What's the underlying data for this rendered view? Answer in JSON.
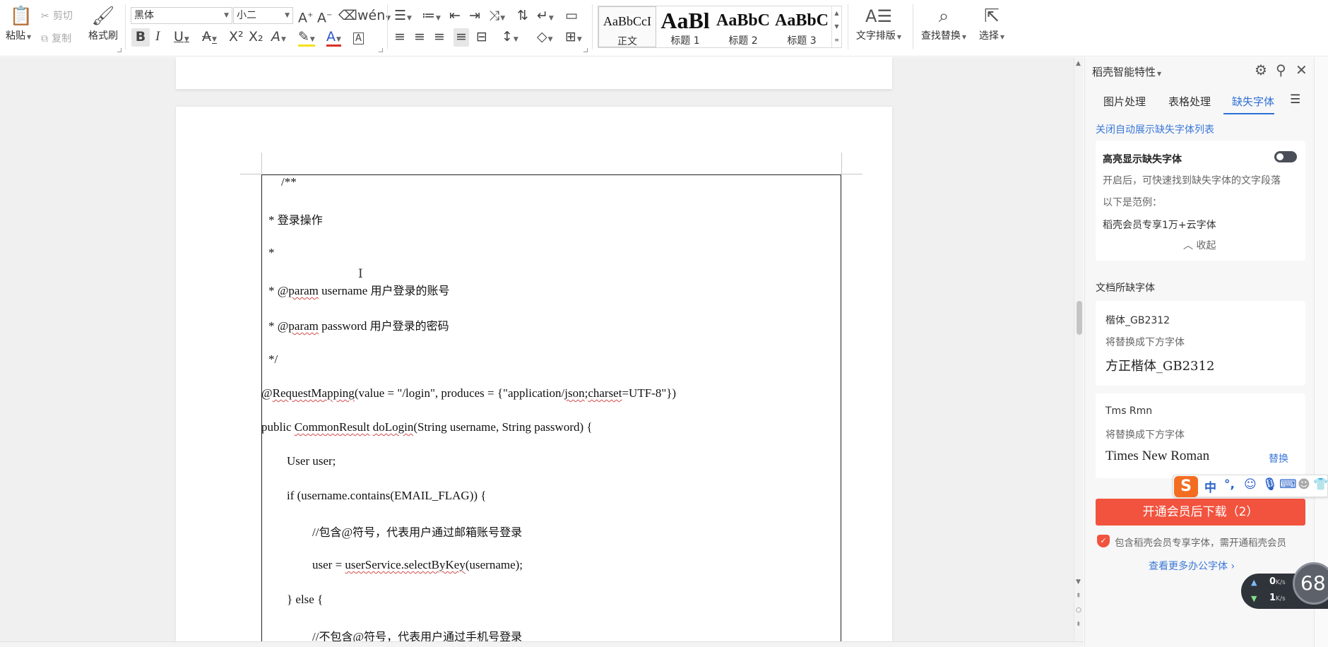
{
  "ribbon": {
    "paste": "粘贴",
    "cut": "剪切",
    "copy": "复制",
    "format_painter": "格式刷",
    "font_name": "黑体",
    "font_size": "小二",
    "styles": [
      {
        "sample": "AaBbCcI",
        "name": "正文"
      },
      {
        "sample": "AaBl",
        "name": "标题 1"
      },
      {
        "sample": "AaBbC",
        "name": "标题 2"
      },
      {
        "sample": "AaBbC",
        "name": "标题 3"
      }
    ],
    "text_layout": "文字排版",
    "find_replace": "查找替换",
    "select": "选择"
  },
  "document": {
    "lines": [
      {
        "segs": [
          {
            "t": "/**"
          }
        ]
      },
      {
        "segs": [
          {
            "t": "*  "
          },
          {
            "t": "登录操作",
            "c": 1
          }
        ]
      },
      {
        "segs": [
          {
            "t": "*"
          }
        ]
      },
      {
        "segs": [
          {
            "t": "* @"
          },
          {
            "t": "param",
            "s": 1
          },
          {
            "t": " username  "
          },
          {
            "t": "用户登录的账号",
            "c": 1
          }
        ]
      },
      {
        "segs": [
          {
            "t": "* @"
          },
          {
            "t": "param",
            "s": 1
          },
          {
            "t": " password  "
          },
          {
            "t": "用户登录的密码",
            "c": 1
          }
        ]
      },
      {
        "segs": [
          {
            "t": "*/"
          }
        ]
      },
      {
        "segs": [
          {
            "t": "@"
          },
          {
            "t": "RequestMapping",
            "s": 1
          },
          {
            "t": "(value = \"/login\", produces = {\"application/"
          },
          {
            "t": "json",
            "s": 1
          },
          {
            "t": ";"
          },
          {
            "t": "charset",
            "s": 1
          },
          {
            "t": "=UTF-8\"})"
          }
        ]
      },
      {
        "segs": [
          {
            "t": "public "
          },
          {
            "t": "CommonResult",
            "s": 1
          },
          {
            "t": " "
          },
          {
            "t": "doLogin",
            "s": 1
          },
          {
            "t": "(String username, String password) {"
          }
        ]
      },
      {
        "segs": [
          {
            "t": "User user;"
          }
        ]
      },
      {
        "segs": [
          {
            "t": "if (username.contains(EMAIL_FLAG)) {"
          }
        ]
      },
      {
        "segs": [
          {
            "t": "//"
          },
          {
            "t": "包含",
            "c": 1
          },
          {
            "t": "@"
          },
          {
            "t": "符号，代表用户通过邮箱账号登录",
            "c": 1
          }
        ]
      },
      {
        "segs": [
          {
            "t": "user = "
          },
          {
            "t": "userService.selectByKey",
            "s": 1
          },
          {
            "t": "(username);"
          }
        ]
      },
      {
        "segs": [
          {
            "t": "} else {"
          }
        ]
      },
      {
        "segs": [
          {
            "t": "//"
          },
          {
            "t": "不包含",
            "c": 1
          },
          {
            "t": "@"
          },
          {
            "t": "符号，代表用户通过手机号登录",
            "c": 1
          }
        ]
      }
    ]
  },
  "panel": {
    "title": "稻壳智能特性",
    "tabs": [
      "图片处理",
      "表格处理",
      "缺失字体"
    ],
    "close_auto_link": "关闭自动展示缺失字体列表",
    "highlight_card": {
      "title": "高亮显示缺失字体",
      "desc": "开启后，可快速找到缺失字体的文字段落",
      "example_label": "以下是范例：",
      "example": "稻壳会员专享1万+云字体",
      "collapse": "收起"
    },
    "missing_title": "文档所缺字体",
    "fonts": [
      {
        "name": "楷体_GB2312",
        "hint": "将替换成下方字体",
        "replacement": "方正楷体_GB2312",
        "action": ""
      },
      {
        "name": "Tms Rmn",
        "hint": "将替换成下方字体",
        "replacement": "Times New Roman",
        "action": "替换"
      }
    ],
    "download_button": "开通会员后下载（2）",
    "member_note": "包含稻壳会员专享字体，需开通稻壳会员",
    "more_fonts_link": "查看更多办公字体"
  },
  "ime": {
    "logo": "S",
    "lang": "中"
  },
  "network": {
    "up": "0",
    "down": "1",
    "unit": "K/s",
    "gauge": "68"
  },
  "colors": {
    "accent": "#2f6fd6",
    "download": "#f2533e",
    "ime": "#f36d21"
  }
}
